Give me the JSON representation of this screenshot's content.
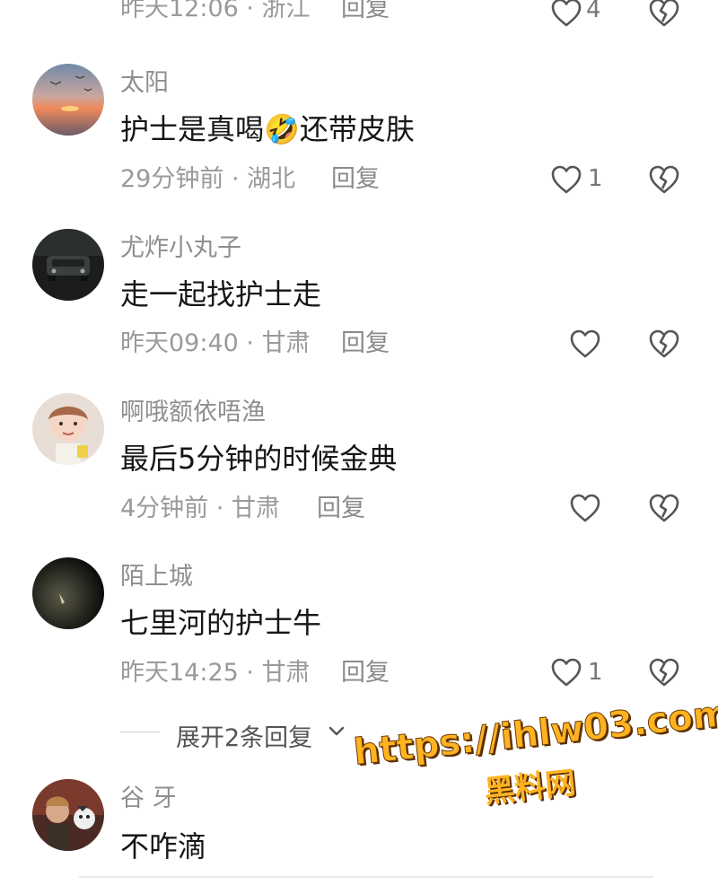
{
  "comments": [
    {
      "username": "",
      "text": "",
      "time": "昨天12:06",
      "location": "浙江",
      "reply": "回复",
      "likes": "4"
    },
    {
      "username": "太阳",
      "text": "护士是真喝🤣还带皮肤",
      "time": "29分钟前",
      "location": "湖北",
      "reply": "回复",
      "likes": "1"
    },
    {
      "username": "尤炸小丸子",
      "text": "走一起找护士走",
      "time": "昨天09:40",
      "location": "甘肃",
      "reply": "回复",
      "likes": ""
    },
    {
      "username": "啊哦额依唔渔",
      "text": "最后5分钟的时候金典",
      "time": "4分钟前",
      "location": "甘肃",
      "reply": "回复",
      "likes": ""
    },
    {
      "username": "陌上城",
      "text": "七里河的护士牛",
      "time": "昨天14:25",
      "location": "甘肃",
      "reply": "回复",
      "likes": "1"
    },
    {
      "username": "谷 牙",
      "text": "不咋滴",
      "time": "",
      "location": "",
      "reply": "",
      "likes": ""
    }
  ],
  "meta_separator": " · ",
  "expand_replies": "展开2条回复",
  "watermark": {
    "url": "https://ihlw03.com",
    "name": "黑料网"
  },
  "colors": {
    "meta": "#9a9a9a",
    "text": "#161616",
    "watermark": "#ffb321"
  },
  "icons": [
    "heart-outline-icon",
    "broken-heart-icon",
    "chevron-down-icon"
  ]
}
